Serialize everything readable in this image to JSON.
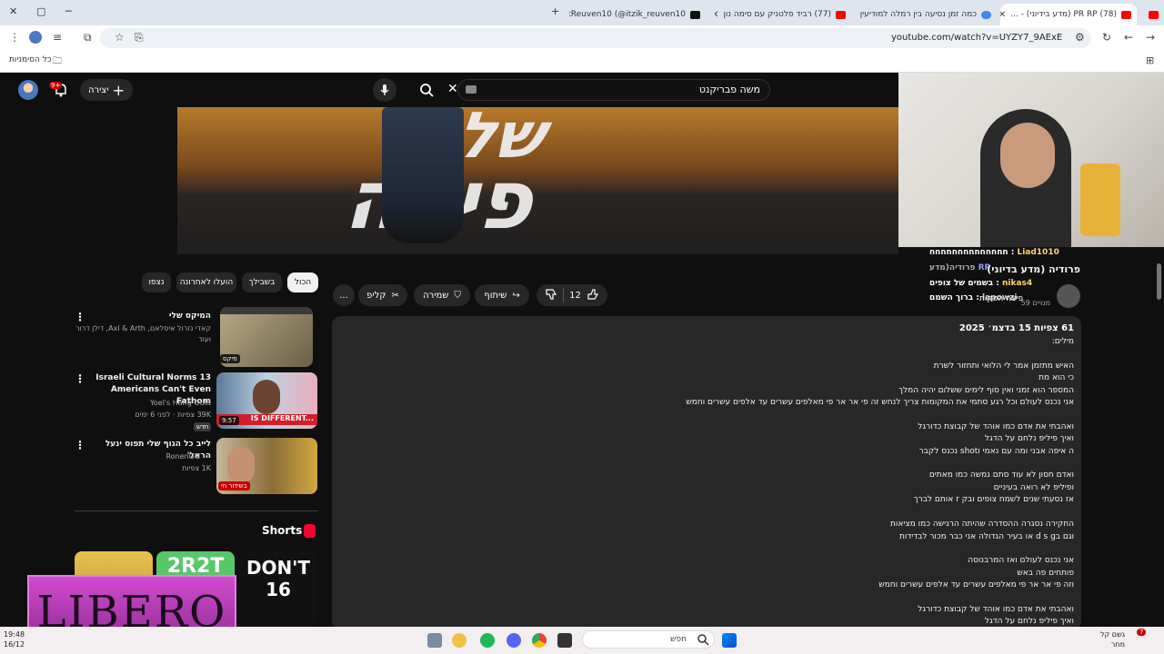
{
  "browser": {
    "tabs": [
      {
        "label": "ItzikReuven10 (@itzik_reuven10",
        "fav": "#111111"
      },
      {
        "label": "(77) רביד פלטניק עם סימה נון",
        "fav": "#ff0000"
      },
      {
        "label": "כמה זמן נסיעה בין רמלה למודיעין",
        "fav": "#4285f4"
      },
      {
        "label": "(78) PR RP (מדע בידיוני) - ...",
        "fav": "#ff0000"
      },
      {
        "label": "ה (מדע בידיוני) ...",
        "fav": "#ff0000"
      }
    ],
    "new_tab": "+",
    "url": "youtube.com/watch?v=UYZY7_9AExE",
    "bookmarks_label": "כל הסימניות"
  },
  "header": {
    "search_query": "משה פבריקנט",
    "create_label": "יצירה",
    "notif_count": "9+"
  },
  "stream_chat": [
    {
      "user": "Liad1010",
      "text": "חחחחחחחחחחחחחח"
    },
    {
      "user": "RP",
      "text": "פרודיה(מדע"
    },
    {
      "user": "nikas4",
      "text": "בשמים של צופים"
    },
    {
      "user": "",
      "text": "פיצה הפקות"
    },
    {
      "user": "lapowzi",
      "text": "ברוך השמם"
    }
  ],
  "video": {
    "title": "פרודיה (מדע בדיוני)",
    "channel": "פיצה הפקות",
    "subs": "59 מנויים",
    "likes": "12",
    "share_label": "שיתוף",
    "save_label": "שמירה",
    "clip_label": "קליפ",
    "more_label": "..."
  },
  "description": {
    "header": "61 צפיות  15 בדצמ׳ 2025",
    "body": "מילים:\n\nהאיש מתזמן אמר לי הלואי ותחזור לשרת\nכי הוא מת\nהמספר הוא זמני ואין סוף לימים ששלום יהיה המלך\nאני נכנס לעולם וכל רגע סתמי את המקומות צריך לנחש זה  פי אר אר פי מאלפים עשרים עד אלפים עשרים וחמש\n\nואהבתי את אדם כמו אוהד של קבוצת כדורגל\nואיך פיליפ נלחם על הדגל\nה איפה אבני ומה עם נאמי וshot נכנס לקבר\n\nואדם חסון לא עוד סתם נמשה כמו מאתים\nופיליפ לא רואה בעיניים\nאז נסעתי שנים לשמח צופים ובק r אותם לברך\n\nהחקירה נסגרה ההסדרה שהיתה הרגישה כמו מציאות\nוגם בd s g או בעיר הגדולה אני כבר מכור לבדידות\n\nאני נכנס לעולם ואז המרבנוסה\nפותחים פה באש\nוזה פי אר אר פי מאלפים עשרים עד אלפים עשרים וחמש\n\nואהבתי את אדם כמו אוהד של קבוצת כדורגל\nואיך פיליפ נלחם על הדגל"
  },
  "filter_chips": [
    "הכול",
    "בשבילך",
    "הועלו לאחרונה",
    "נצפו"
  ],
  "recommended": [
    {
      "title": "המיקס שלי",
      "meta1": "קאדי נזרול איסלאם, Axl & Arth, דילן דרור ועוד",
      "meta2": "",
      "badge": "מיקס",
      "tag": ""
    },
    {
      "title": "13 Israeli Cultural Norms Americans Can't Even Fathom",
      "meta1": "Yoel's Hang Outs",
      "meta2": "39K צפיות · לפני 6 ימים",
      "badge": "9:57",
      "tag": "חדש"
    },
    {
      "title": "לייב כל הגוף שלי תפוס ינעל הראל'",
      "meta1": "RonenGG",
      "meta2": "1K צפיות",
      "badge": "בשידור חי",
      "tag": ""
    }
  ],
  "shorts_label": "Shorts",
  "shorts": [
    "",
    "2R2T",
    "DON'T 16"
  ],
  "overlay_logo": "LIBERO",
  "taskbar": {
    "search_placeholder": "חפש",
    "time": "19:48",
    "date": "16/12",
    "weather": "גשם קל",
    "weather_sub": "מחר",
    "weather_badge": "7"
  }
}
